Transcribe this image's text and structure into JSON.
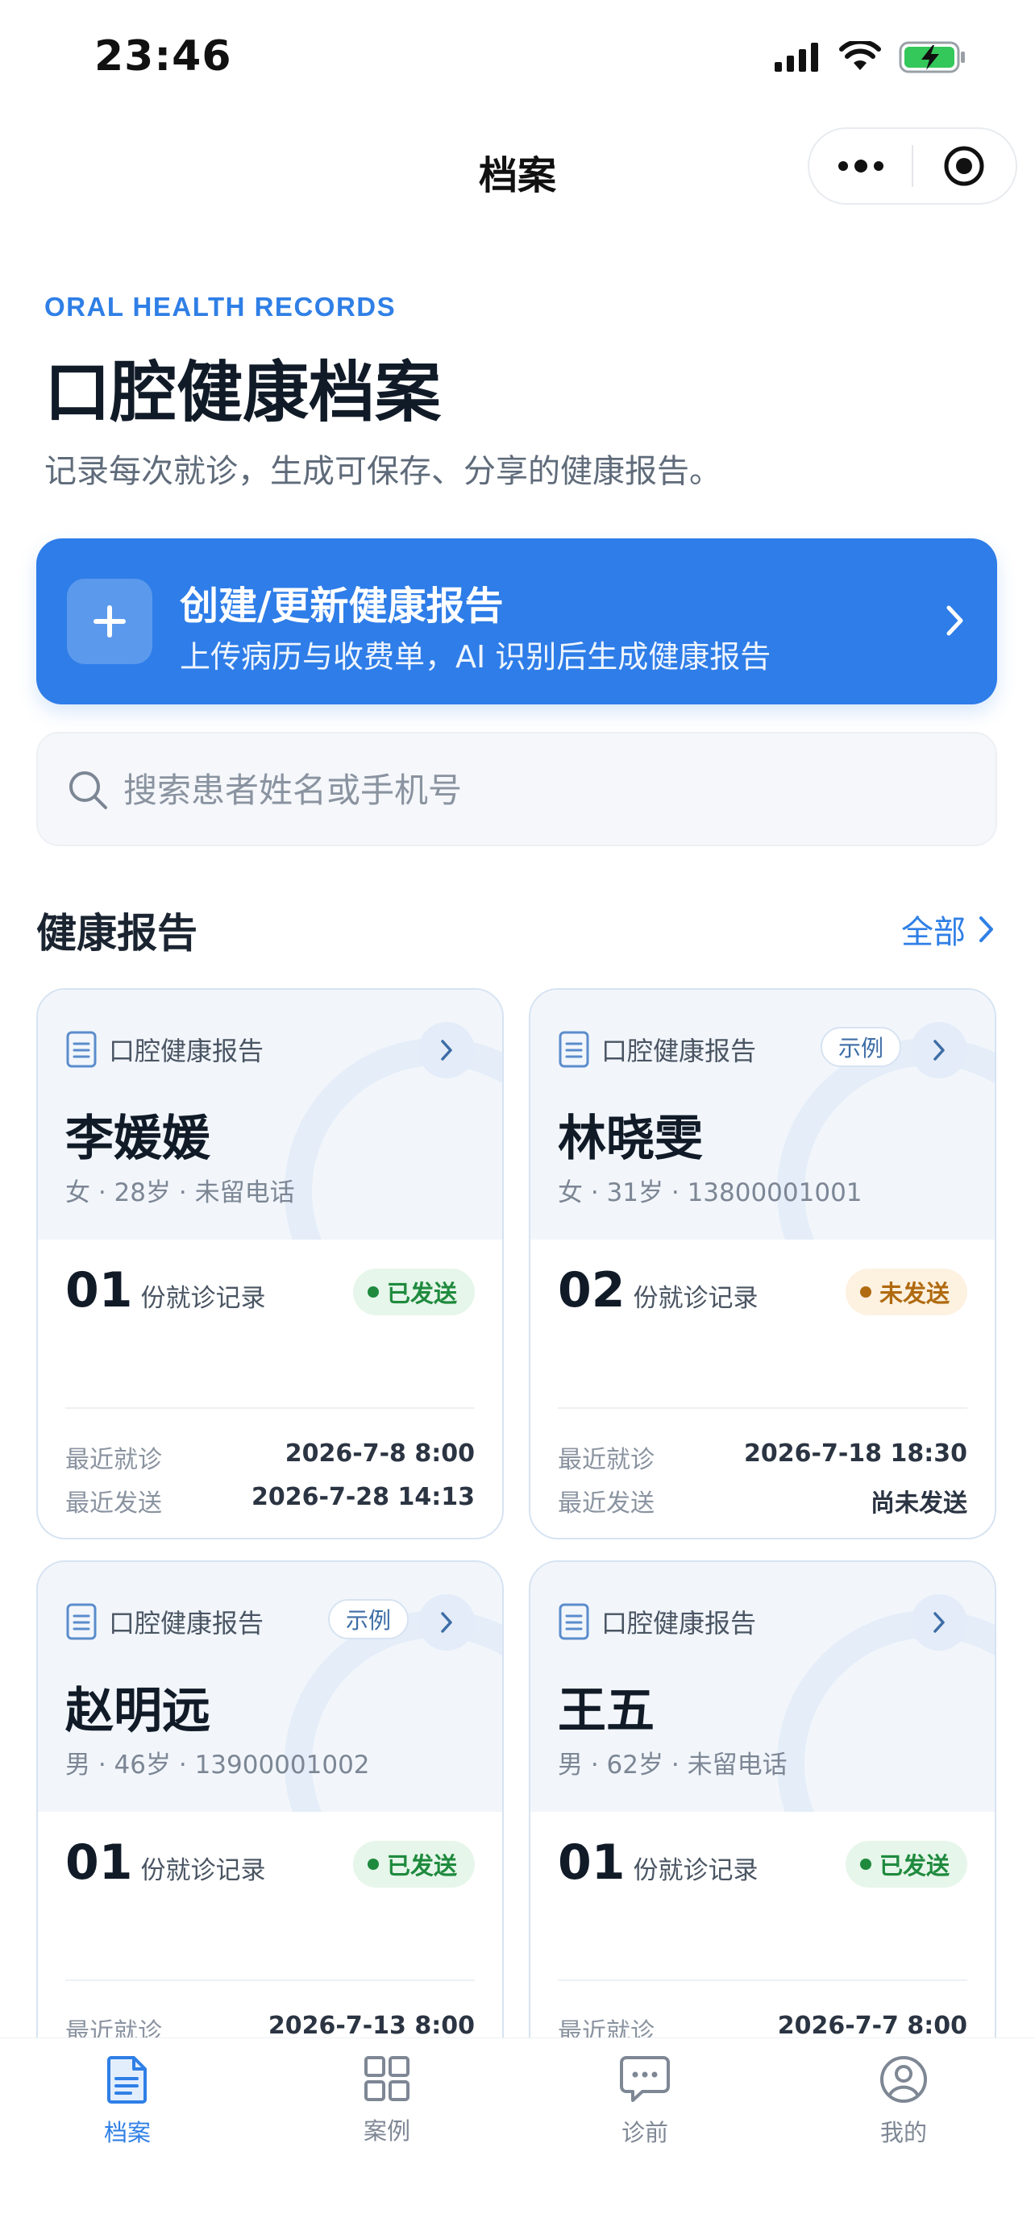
{
  "status_bar": {
    "time": "23:46"
  },
  "nav": {
    "title": "档案"
  },
  "hero": {
    "eyebrow": "ORAL HEALTH RECORDS",
    "title": "口腔健康档案",
    "subtitle": "记录每次就诊，生成可保存、分享的健康报告。"
  },
  "create_banner": {
    "title": "创建/更新健康报告",
    "description": "上传病历与收费单，AI 识别后生成健康报告"
  },
  "search": {
    "placeholder": "搜索患者姓名或手机号",
    "value": ""
  },
  "reports_section": {
    "title": "健康报告",
    "all_label": "全部"
  },
  "reports": [
    {
      "type": "口腔健康报告",
      "example": "",
      "name": "李媛媛",
      "meta": "女 · 28岁 · 未留电话",
      "count": "01",
      "count_unit": "份就诊记录",
      "status": "已发送",
      "status_kind": "sent",
      "last_visit_label": "最近就诊",
      "last_visit": "2026-7-8 8:00",
      "last_sent_label": "最近发送",
      "last_sent": "2026-7-28 14:13"
    },
    {
      "type": "口腔健康报告",
      "example": "示例",
      "name": "林晓雯",
      "meta": "女 · 31岁 · 13800001001",
      "count": "02",
      "count_unit": "份就诊记录",
      "status": "未发送",
      "status_kind": "unsent",
      "last_visit_label": "最近就诊",
      "last_visit": "2026-7-18 18:30",
      "last_sent_label": "最近发送",
      "last_sent": "尚未发送"
    },
    {
      "type": "口腔健康报告",
      "example": "示例",
      "name": "赵明远",
      "meta": "男 · 46岁 · 13900001002",
      "count": "01",
      "count_unit": "份就诊记录",
      "status": "已发送",
      "status_kind": "sent",
      "last_visit_label": "最近就诊",
      "last_visit": "2026-7-13 8:00"
    },
    {
      "type": "口腔健康报告",
      "example": "",
      "name": "王五",
      "meta": "男 · 62岁 · 未留电话",
      "count": "01",
      "count_unit": "份就诊记录",
      "status": "已发送",
      "status_kind": "sent",
      "last_visit_label": "最近就诊",
      "last_visit": "2026-7-7 8:00"
    }
  ],
  "tabbar": {
    "items": [
      {
        "label": "档案",
        "icon": "document-icon",
        "active": true
      },
      {
        "label": "案例",
        "icon": "grid-icon",
        "active": false
      },
      {
        "label": "诊前",
        "icon": "chat-icon",
        "active": false
      },
      {
        "label": "我的",
        "icon": "user-icon",
        "active": false
      }
    ]
  },
  "colors": {
    "accent": "#2e7de8",
    "sent": "#1f8a3e",
    "unsent": "#b06a10"
  }
}
